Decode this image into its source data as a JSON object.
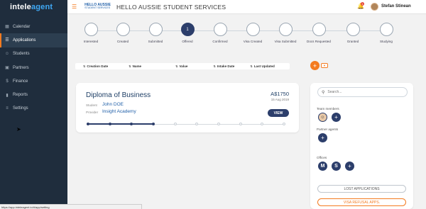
{
  "logo": {
    "part1": "intele",
    "part2": "agent"
  },
  "sidebar": {
    "items": [
      {
        "label": "Calendar",
        "icon": "calendar-icon"
      },
      {
        "label": "Applications",
        "icon": "list-icon",
        "active": true
      },
      {
        "label": "Students",
        "icon": "users-icon"
      },
      {
        "label": "Partners",
        "icon": "briefcase-icon"
      },
      {
        "label": "Finance",
        "icon": "dollar-icon"
      },
      {
        "label": "Reports",
        "icon": "chart-icon"
      },
      {
        "label": "Settings",
        "icon": "sliders-icon"
      }
    ]
  },
  "header": {
    "brand_line1": "HELLO AUSSIE",
    "brand_line2": "STUDENT SERVICES",
    "title": "HELLO AUSSIE STUDENT SERVICES",
    "notification_count": "1",
    "user_name": "Stefan Stinean"
  },
  "steps": [
    {
      "label": "Interested"
    },
    {
      "label": "Created"
    },
    {
      "label": "Submitted"
    },
    {
      "label": "Offered",
      "number": "1",
      "current": true
    },
    {
      "label": "Confirmed"
    },
    {
      "label": "Visa Created"
    },
    {
      "label": "Visa Submitted"
    },
    {
      "label": "Docs Requested"
    },
    {
      "label": "Granted"
    },
    {
      "label": "Studying"
    }
  ],
  "sort": {
    "creation_date": "Creation Date",
    "name": "Name",
    "value": "Value",
    "intake_date": "Intake Date",
    "last_updated": "Last Updated"
  },
  "application": {
    "title": "Diploma of Business",
    "amount": "A$1750",
    "date": "15 Aug 2019",
    "student_label": "Student",
    "student": "John DOE",
    "provider_label": "Provider",
    "provider": "Insight Academy",
    "view_label": "VIEW",
    "progress_steps_done": 4,
    "progress_steps_total": 10
  },
  "panel": {
    "search_placeholder": "Search...",
    "team_members_label": "Team members",
    "partner_agents_label": "Partner agents",
    "offices_label": "Offices",
    "office_m": "M",
    "office_s": "S",
    "lost_applications": "LOST APPLICATIONS",
    "visa_refusal": "VISA REFUSAL APPS."
  },
  "status_url": "https://app.inteleagent.io/#/app/setting",
  "colors": {
    "accent": "#f47b20",
    "primary": "#2c3e6b",
    "sidebar_bg": "#1f2d3d"
  }
}
